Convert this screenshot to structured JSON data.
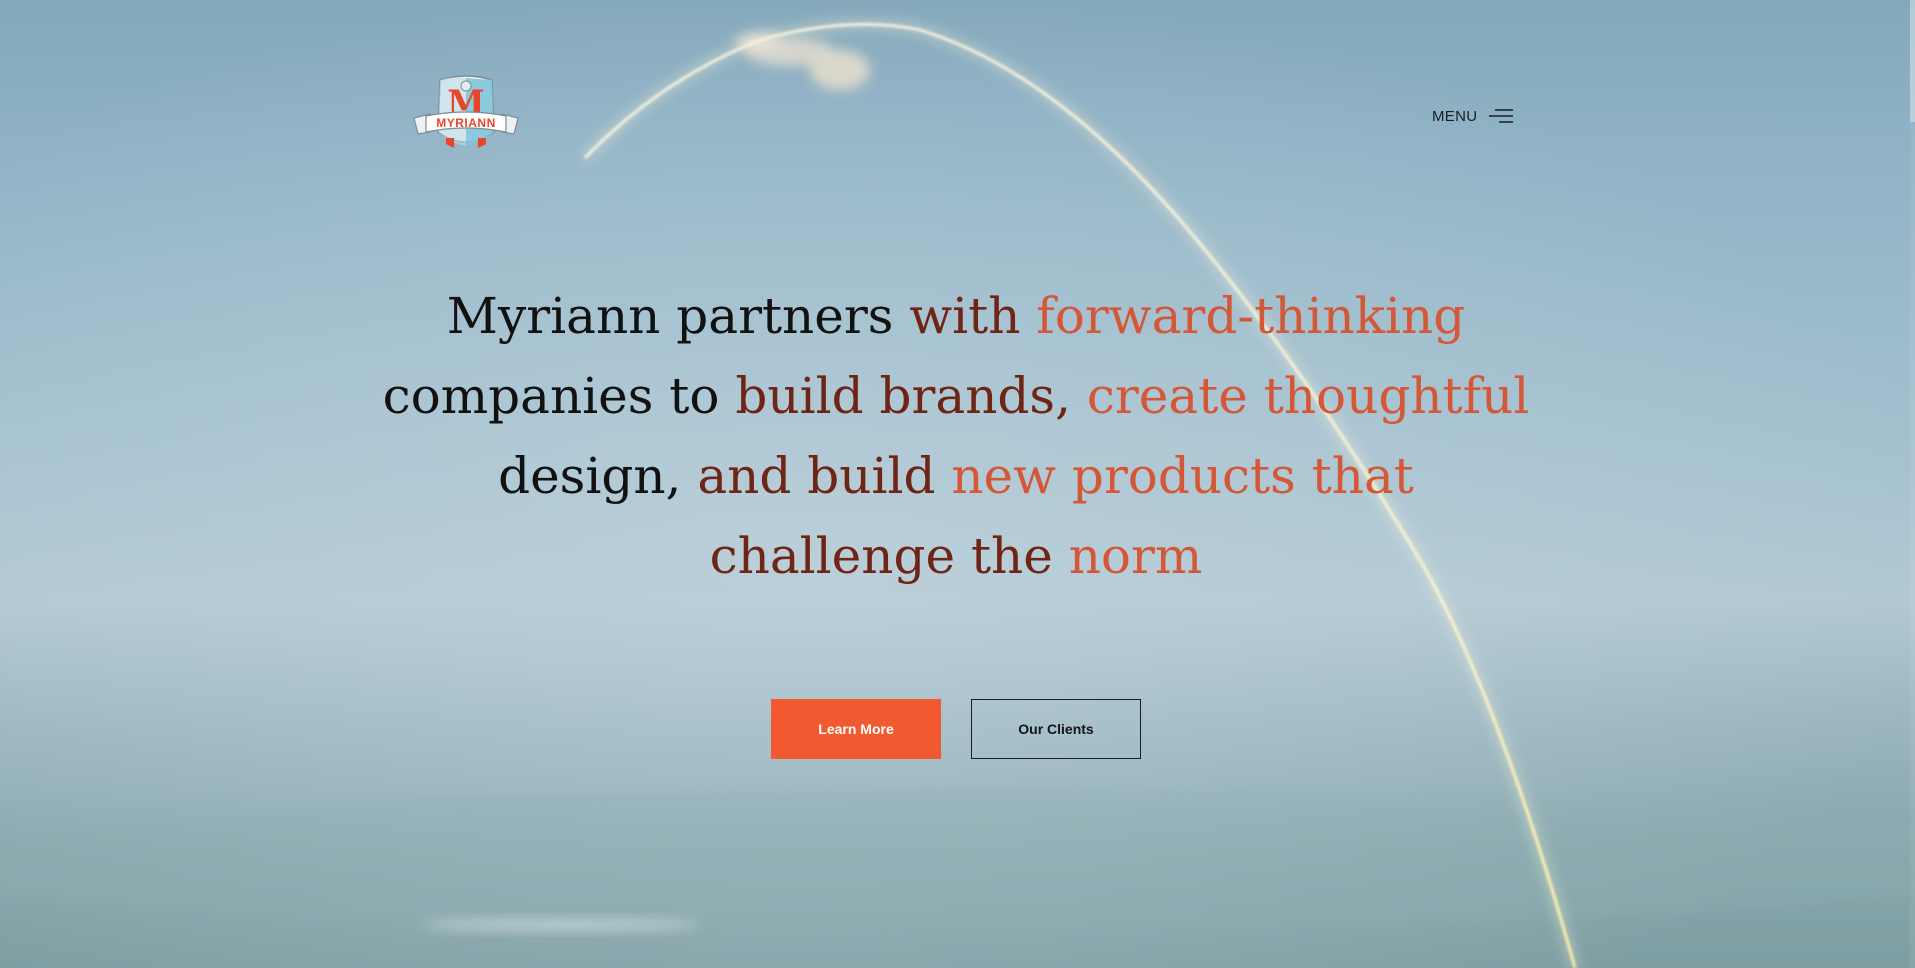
{
  "colors": {
    "accent": "#f15a31",
    "headline_dark": "#111111",
    "headline_mid": "#6e2515",
    "headline_light": "#d45837",
    "sky_top": "#84a8bb",
    "sky_horizon": "#b1c8d3"
  },
  "logo": {
    "text": "MYRIANN",
    "monogram": "M"
  },
  "nav": {
    "menu_label": "MENU",
    "menu_icon": "hamburger-icon"
  },
  "hero": {
    "headline_segments": [
      {
        "text": "Myriann ",
        "tone": "dark"
      },
      {
        "text": "partners ",
        "tone": "dark"
      },
      {
        "text": "with ",
        "tone": "mid"
      },
      {
        "text": "forward-thinking",
        "tone": "light"
      },
      {
        "text": "companies ",
        "tone": "dark"
      },
      {
        "text": "to ",
        "tone": "dark"
      },
      {
        "text": "build ",
        "tone": "mid"
      },
      {
        "text": "brands, ",
        "tone": "mid"
      },
      {
        "text": "create ",
        "tone": "light"
      },
      {
        "text": "thoughtful",
        "tone": "light"
      },
      {
        "text": "design, ",
        "tone": "dark"
      },
      {
        "text": "and ",
        "tone": "mid"
      },
      {
        "text": "build ",
        "tone": "mid"
      },
      {
        "text": "new ",
        "tone": "light"
      },
      {
        "text": "products ",
        "tone": "light"
      },
      {
        "text": "that",
        "tone": "light"
      },
      {
        "text": "challenge ",
        "tone": "mid"
      },
      {
        "text": "the ",
        "tone": "mid"
      },
      {
        "text": "norm",
        "tone": "light"
      }
    ]
  },
  "cta": {
    "primary_label": "Learn More",
    "secondary_label": "Our Clients"
  }
}
